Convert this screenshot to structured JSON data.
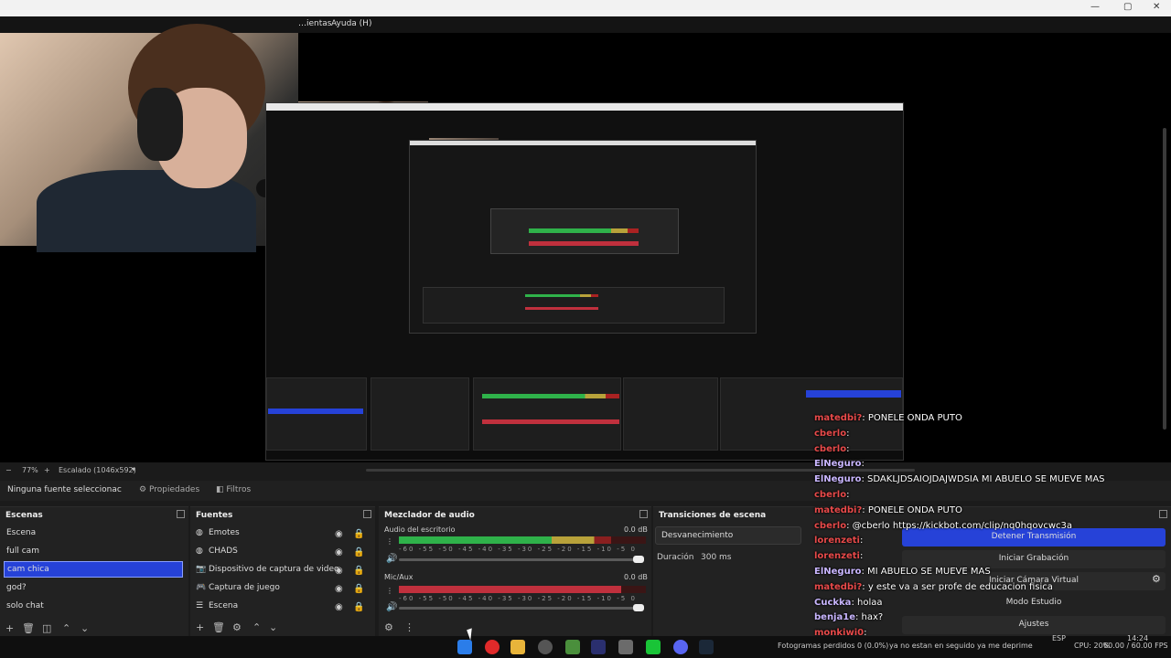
{
  "menubar": {
    "items": [
      "…ientas",
      "Ayuda (H)"
    ]
  },
  "status": {
    "zoom": "77%",
    "scale_label": "Escalado (1046x592)"
  },
  "toolbar": {
    "no_source": "Ninguna fuente seleccionac",
    "properties": "Propiedades",
    "filters": "Filtros"
  },
  "scenes": {
    "title": "Escenas",
    "items": [
      "Escena",
      "full cam",
      "cam chica",
      "god?",
      "solo chat"
    ],
    "selected_index": 2
  },
  "sources": {
    "title": "Fuentes",
    "items": [
      "Emotes",
      "CHADS",
      "Dispositivo de captura de video",
      "Captura de juego",
      "Escena"
    ]
  },
  "mixer": {
    "title": "Mezclador de audio",
    "channels": [
      {
        "name": "Audio del escritorio",
        "db": "0.0 dB",
        "level": 0.86,
        "color": "#2fb24a"
      },
      {
        "name": "Mic/Aux",
        "db": "0.0 dB",
        "level": 0.9,
        "color": "#c0303d"
      }
    ],
    "ticks": "-60 -55 -50 -45 -40 -35 -30 -25 -20 -15 -10 -5 0"
  },
  "transitions": {
    "title": "Transiciones de escena",
    "selected": "Desvanecimiento",
    "duration_label": "Duración",
    "duration_value": "300 ms"
  },
  "controls": {
    "stop_stream": "Detener Transmisión",
    "start_record": "Iniciar Grabación",
    "virtual_cam": "Iniciar Cámara Virtual",
    "studio_mode": "Modo Estudio",
    "settings": "Ajustes"
  },
  "chat": [
    {
      "user": "matedbi?",
      "text": ": PONELE ONDA PUTO"
    },
    {
      "user": "cberlo",
      "text": ":"
    },
    {
      "user": "cberlo",
      "text": ":"
    },
    {
      "user": "ElNeguro",
      "text": ":"
    },
    {
      "user": "ElNeguro",
      "text": ": SDAKLJDSAIOJDAJWDSIA MI ABUELO SE MUEVE MAS"
    },
    {
      "user": "cberlo",
      "text": ":"
    },
    {
      "user": "matedbi?",
      "text": ": PONELE ONDA PUTO"
    },
    {
      "user": "cberlo",
      "text": ": @cberlo https://kickbot.com/clip/nq0hqovcwc3a"
    },
    {
      "user": "lorenzeti",
      "text": ":"
    },
    {
      "user": "lorenzeti",
      "text": ":"
    },
    {
      "user": "ElNeguro",
      "text": ": MI ABUELO SE MUEVE MAS"
    },
    {
      "user": "matedbi?",
      "text": ": y este va a ser profe de educacion fisica"
    },
    {
      "user": "Cuckka",
      "text": ": holaa"
    },
    {
      "user": "benja1e",
      "text": ": hax?"
    },
    {
      "user": "monkiwi0",
      "text": ":"
    }
  ],
  "statusbar": {
    "text": "Fotogramas perdidos 0 (0.0%)",
    "overlay": "ya no estan en seguido ya me deprime"
  },
  "tray": {
    "lang": "ESP",
    "cpu": "CPU: 20%",
    "fps": "60.00 / 60.00 FPS",
    "time": "14:24"
  },
  "colors": {
    "accent": "#2642d8",
    "meter_green": "#2fb24a",
    "meter_red": "#c0303d",
    "chat_user": "#e84a4a"
  }
}
